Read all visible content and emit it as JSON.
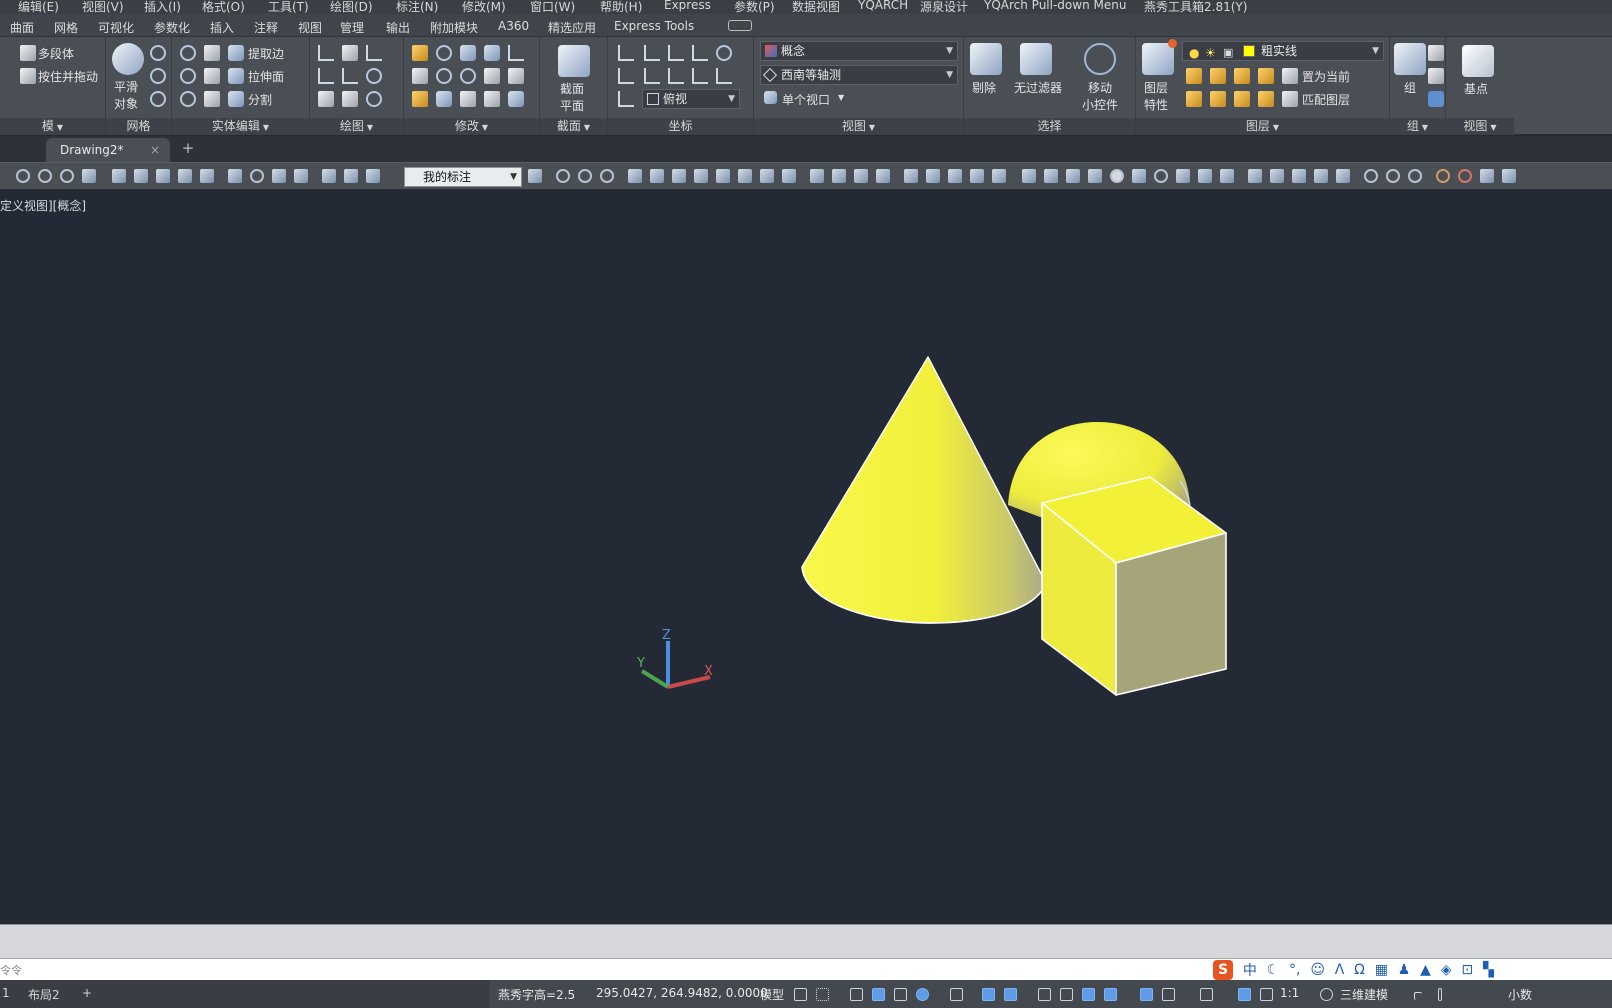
{
  "menu": [
    "编辑(E)",
    "视图(V)",
    "插入(I)",
    "格式(O)",
    "工具(T)",
    "绘图(D)",
    "标注(N)",
    "修改(M)",
    "窗口(W)",
    "帮助(H)",
    "Express",
    "参数(P)",
    "数据视图",
    "YQARCH",
    "源泉设计",
    "YQArch Pull-down Menu",
    "燕秀工具箱2.81(Y)"
  ],
  "ribbon_tabs": [
    "曲面",
    "网格",
    "可视化",
    "参数化",
    "插入",
    "注释",
    "视图",
    "管理",
    "输出",
    "附加模块",
    "A360",
    "精选应用",
    "Express Tools"
  ],
  "ribbon": {
    "modeling": {
      "polysolid": "多段体",
      "presspull": "按住并拖动",
      "title": "模"
    },
    "mesh": {
      "smooth": "平滑",
      "object": "对象",
      "title": "网格"
    },
    "solid_edit": {
      "extract_edges": "提取边",
      "extrude_faces": "拉伸面",
      "separate": "分割",
      "title": "实体编辑"
    },
    "draw": {
      "title": "绘图"
    },
    "modify": {
      "title": "修改"
    },
    "section": {
      "section_plane_1": "截面",
      "section_plane_2": "平面",
      "title": "截面"
    },
    "coordinates": {
      "view_combo": "俯视",
      "title": "坐标"
    },
    "view": {
      "visual_style": "概念",
      "view_direction": "西南等轴测",
      "single_viewport": "单个视口",
      "title": "视图"
    },
    "selection": {
      "cull": "剔除",
      "no_filter": "无过滤器",
      "gizmo_1": "移动",
      "gizmo_2": "小控件",
      "title": "选择"
    },
    "layers": {
      "props_1": "图层",
      "props_2": "特性",
      "layer_name": "粗实线",
      "make_current": "置为当前",
      "match_layer": "匹配图层",
      "title": "图层",
      "layer_color": "#ffff00"
    },
    "groups": {
      "group": "组",
      "title": "组"
    },
    "view2": {
      "base_point": "基点",
      "title": "视图"
    }
  },
  "file_tab": {
    "name": "Drawing2*",
    "close": "×",
    "add": "+"
  },
  "toolbar": {
    "dim_style": "我的标注"
  },
  "viewport": {
    "label": "定义视图][概念]"
  },
  "ucs": {
    "x": "X",
    "y": "Y",
    "z": "Z"
  },
  "command": {
    "prompt": "令令"
  },
  "layouts": {
    "layout1": "1",
    "layout2": "布局2",
    "add": "+"
  },
  "status": {
    "text_height": "燕秀字高=2.5",
    "coords": "295.0427, 264.9482, 0.0000",
    "model": "模型",
    "scale": "1:1",
    "workspace": "三维建模",
    "units": "小数"
  },
  "ime": {
    "lang": "中"
  },
  "colors": {
    "solid_yellow": "#f2f03a",
    "viewport_bg": "#232a36",
    "ribbon_bg": "#4a4e55"
  }
}
